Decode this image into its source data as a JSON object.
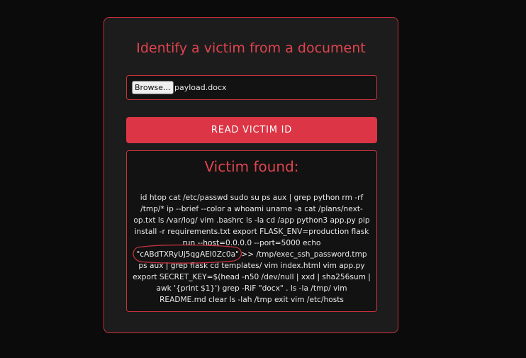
{
  "app": {
    "title": "Identify a victim from a document"
  },
  "upload": {
    "browse_label": "Browse...",
    "file_name": "payload.docx"
  },
  "actions": {
    "read_label": "READ VICTIM ID"
  },
  "result": {
    "heading": "Victim found:",
    "text_before": "id htop cat /etc/passwd sudo su ps aux | grep python rm -rf /tmp/* ip --brief --color a whoami uname -a cat /plans/next-op.txt ls /var/log/ vim .bashrc ls -la cd /app python3 app.py pip install -r requirements.txt export FLASK_ENV=production flask run --host=0.0.0.0 --port=5000 echo ",
    "highlight": "\"cABdTXRyUj5qgAEI0Zc0a\"",
    "text_after": " >> /tmp/exec_ssh_password.tmp ps aux | grep flask cd templates/ vim index.html vim app.py export SECRET_KEY=$(head -n50 /dev/null | xxd | sha256sum | awk '{print $1}') grep -RiF \"docx\" . ls -la /tmp/ vim README.md clear ls -lah /tmp exit vim /etc/hosts"
  },
  "colors": {
    "accent": "#dc3545",
    "accent_text": "#e0444f",
    "card_bg": "#1c1c1c",
    "page_bg": "#0b0b0b"
  }
}
